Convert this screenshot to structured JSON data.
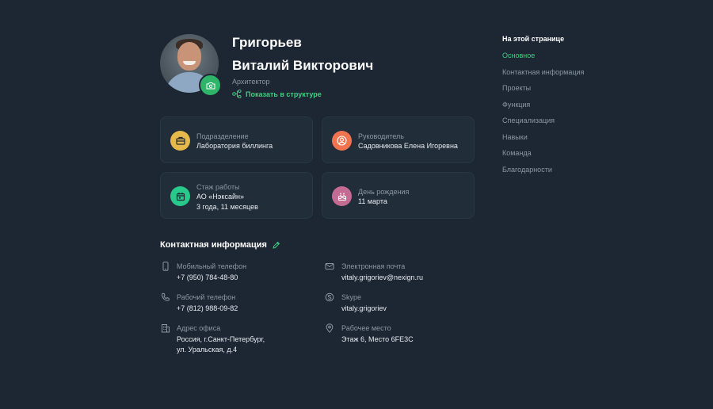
{
  "profile": {
    "last_name": "Григорьев",
    "first_middle": "Виталий Викторович",
    "role": "Архитектор",
    "structure_link": "Показать в структуре"
  },
  "cards": {
    "department": {
      "label": "Подразделение",
      "value": "Лаборатория биллинга",
      "color": "#e5b94a"
    },
    "manager": {
      "label": "Руководитель",
      "value": "Садовникова Елена Игоревна",
      "color": "#f0744f"
    },
    "experience": {
      "label": "Стаж работы",
      "value1": "АО «Нэксайн»",
      "value2": "3 года, 11 месяцев",
      "color": "#28c98a"
    },
    "birthday": {
      "label": "День рождения",
      "value": "11 марта",
      "color": "#c46b93"
    }
  },
  "contacts": {
    "title": "Контактная информация",
    "mobile": {
      "label": "Мобильный телефон",
      "value": "+7 (950) 784-48-80"
    },
    "email": {
      "label": "Электронная почта",
      "value": "vitaly.grigoriev@nexign.ru"
    },
    "work_phone": {
      "label": "Рабочий телефон",
      "value": "+7 (812) 988-09-82"
    },
    "skype": {
      "label": "Skype",
      "value": "vitaly.grigoriev"
    },
    "office": {
      "label": "Адрес офиса",
      "value1": "Россия, г.Санкт-Петербург,",
      "value2": "ул. Уральская, д.4"
    },
    "workplace": {
      "label": "Рабочее место",
      "value": "Этаж 6, Место 6FE3C"
    }
  },
  "nav": {
    "title": "На этой странице",
    "items": [
      "Основное",
      "Контактная информация",
      "Проекты",
      "Функция",
      "Специализация",
      "Навыки",
      "Команда",
      "Благодарности"
    ],
    "active_color": "#3fcf7e"
  }
}
